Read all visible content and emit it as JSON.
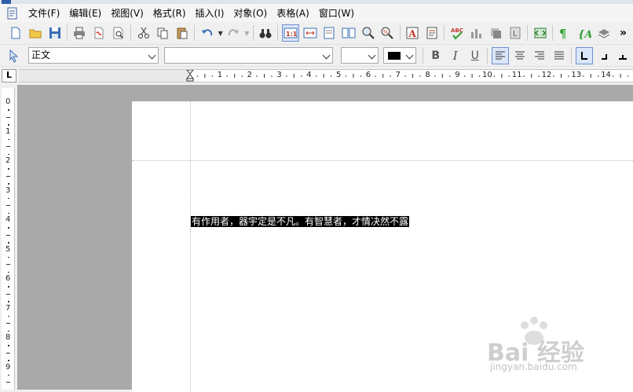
{
  "menubar": {
    "items": [
      "文件(F)",
      "编辑(E)",
      "视图(V)",
      "格式(R)",
      "插入(I)",
      "对象(O)",
      "表格(A)",
      "窗口(W)"
    ]
  },
  "toolbar2": {
    "paragraph_style": "正文",
    "font_name": "",
    "font_size": "",
    "bold_label": "B",
    "italic_label": "I",
    "underline_label": "U"
  },
  "ruler": {
    "horizontal_numbers": [
      "1",
      "2",
      "3",
      "4",
      "5",
      "6",
      "7",
      "8",
      "9",
      "10",
      "11",
      "12",
      "13",
      "14"
    ],
    "vertical_numbers": [
      "0",
      "1",
      "2",
      "3",
      "4",
      "5",
      "6",
      "7",
      "8",
      "9"
    ],
    "corner_label": "L"
  },
  "document": {
    "selected_text": "有作用者，器宇定是不凡。有智慧者，才情决然不露"
  },
  "watermark": {
    "brand": "Bai 经验",
    "url": "jingyan.baidu.com"
  },
  "colors": {
    "accent": "#2f5ea8",
    "page": "#ffffff",
    "workspace": "#a9a9a9",
    "selection": "#000000"
  }
}
